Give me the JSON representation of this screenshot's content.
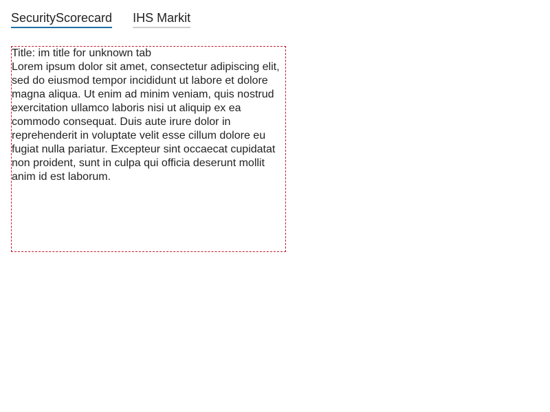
{
  "tabs": [
    {
      "label": "SecurityScorecard",
      "active": true
    },
    {
      "label": "IHS Markit",
      "active": false
    }
  ],
  "panel": {
    "title": "Title: im title for unknown tab",
    "body": "Lorem ipsum dolor sit amet, consectetur adipiscing elit, sed do eiusmod tempor incididunt ut labore et dolore magna aliqua. Ut enim ad minim veniam, quis nostrud exercitation ullamco laboris nisi ut aliquip ex ea commodo consequat. Duis aute irure dolor in reprehenderit in voluptate velit esse cillum dolore eu fugiat nulla pariatur. Excepteur sint occaecat cupidatat non proident, sunt in culpa qui officia deserunt mollit anim id est laborum."
  },
  "colors": {
    "active_tab_underline": "#1f6fa7",
    "inactive_tab_underline": "#cccccc",
    "panel_border": "#c0182b"
  }
}
